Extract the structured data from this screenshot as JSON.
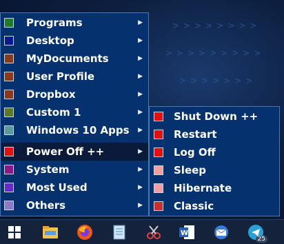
{
  "main_menu": {
    "items": [
      {
        "label": "Programs",
        "color": "#1f7a2e"
      },
      {
        "label": "Desktop",
        "color": "#0a1a8c"
      },
      {
        "label": "MyDocuments",
        "color": "#8a3a1a"
      },
      {
        "label": "User Profile",
        "color": "#8a3a1a"
      },
      {
        "label": "Dropbox",
        "color": "#8a3a1a"
      },
      {
        "label": "Custom 1",
        "color": "#5a7a2a"
      },
      {
        "label": "Windows 10 Apps",
        "color": "#5a9a9a"
      },
      {
        "label": "Power Off ++",
        "color": "#e31010"
      },
      {
        "label": "System",
        "color": "#8a1a8a"
      },
      {
        "label": "Most Used",
        "color": "#6a2ac8"
      },
      {
        "label": "Others",
        "color": "#8a7ac8"
      }
    ],
    "active_item": "Power Off ++"
  },
  "sub_menu": {
    "items": [
      {
        "label": "Shut Down ++",
        "color": "#e31010"
      },
      {
        "label": "Restart",
        "color": "#e31010"
      },
      {
        "label": "Log Off",
        "color": "#e31010"
      },
      {
        "label": "Sleep",
        "color": "#f0a0a0"
      },
      {
        "label": "Hibernate",
        "color": "#f0a0a0"
      },
      {
        "label": "Classic",
        "color": "#c83030"
      }
    ]
  },
  "taskbar": {
    "icons": [
      "windows-start-icon",
      "file-explorer-icon",
      "firefox-icon",
      "notepad-icon",
      "snipping-tool-icon",
      "word-icon",
      "mail-icon",
      "telegram-icon"
    ],
    "telegram_badge": "25"
  }
}
